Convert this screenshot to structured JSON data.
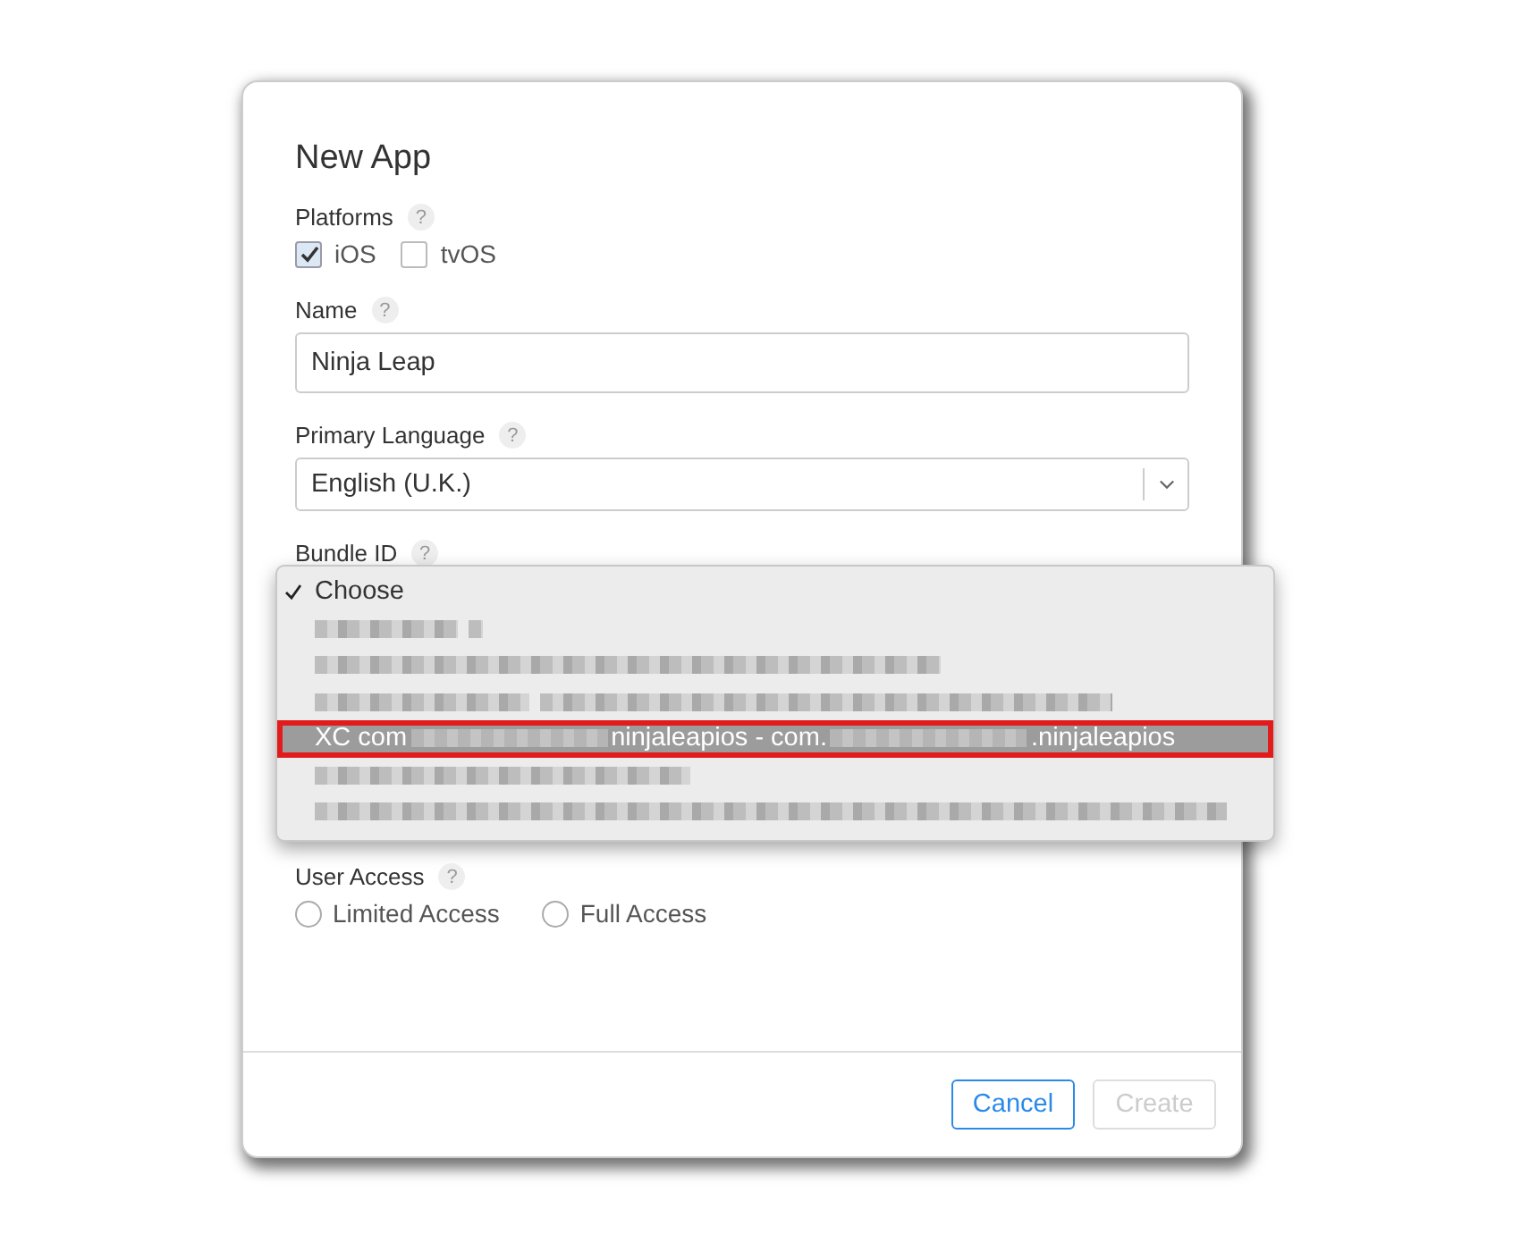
{
  "dialog": {
    "title": "New App",
    "platforms": {
      "label": "Platforms",
      "help": "?",
      "options": [
        {
          "label": "iOS",
          "checked": true
        },
        {
          "label": "tvOS",
          "checked": false
        }
      ]
    },
    "name": {
      "label": "Name",
      "help": "?",
      "value": "Ninja Leap"
    },
    "primary_language": {
      "label": "Primary Language",
      "help": "?",
      "value": "English (U.K.)"
    },
    "bundle_id": {
      "label": "Bundle ID",
      "help": "?",
      "menu": [
        {
          "kind": "text",
          "text": "Choose",
          "checked": true,
          "selected": false
        },
        {
          "kind": "redacted",
          "checked": false,
          "selected": false
        },
        {
          "kind": "redacted",
          "checked": false,
          "selected": false
        },
        {
          "kind": "redacted",
          "checked": false,
          "selected": false
        },
        {
          "kind": "mixed",
          "checked": false,
          "selected": true,
          "segments": [
            {
              "kind": "text",
              "text": "XC com"
            },
            {
              "kind": "redacted"
            },
            {
              "kind": "text",
              "text": "ninjaleapios - com."
            },
            {
              "kind": "redacted"
            },
            {
              "kind": "text",
              "text": ".ninjaleapios"
            }
          ]
        },
        {
          "kind": "redacted",
          "checked": false,
          "selected": false
        },
        {
          "kind": "redacted",
          "checked": false,
          "selected": false
        }
      ]
    },
    "user_access": {
      "label": "User Access",
      "help": "?",
      "options": [
        {
          "label": "Limited Access",
          "selected": false
        },
        {
          "label": "Full Access",
          "selected": false
        }
      ]
    },
    "buttons": [
      {
        "label": "Cancel",
        "disabled": false
      },
      {
        "label": "Create",
        "disabled": true
      }
    ]
  }
}
